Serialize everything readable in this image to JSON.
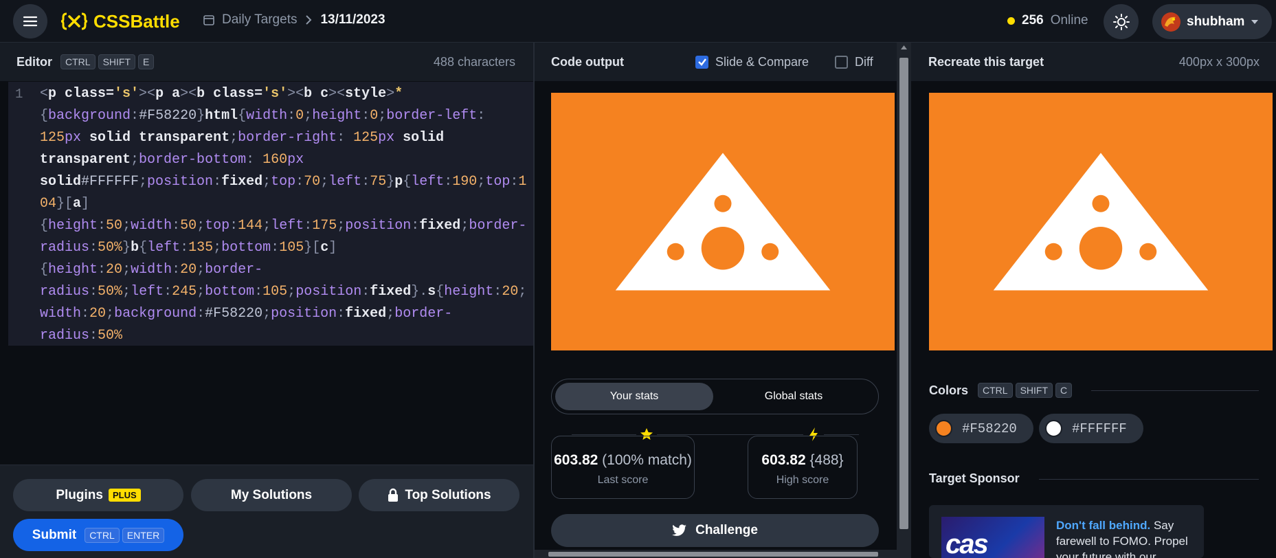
{
  "header": {
    "logo_text": "CSSBattle",
    "breadcrumb_section": "Daily Targets",
    "breadcrumb_date": "13/11/2023",
    "online_count": "256",
    "online_label": "Online",
    "username": "shubham"
  },
  "editor": {
    "title": "Editor",
    "shortcut": [
      "CTRL",
      "SHIFT",
      "E"
    ],
    "char_count": "488 characters",
    "line_number": "1"
  },
  "buttons": {
    "plugins": "Plugins",
    "plugins_badge": "PLUS",
    "my_solutions": "My Solutions",
    "top_solutions": "Top Solutions",
    "submit": "Submit",
    "submit_shortcut": [
      "CTRL",
      "ENTER"
    ]
  },
  "output": {
    "title": "Code output",
    "slide_compare": "Slide & Compare",
    "slide_compare_checked": true,
    "diff": "Diff",
    "diff_checked": false
  },
  "stats": {
    "tab_yours": "Your stats",
    "tab_global": "Global stats",
    "last_score": "603.82",
    "last_score_detail": "(100% match)",
    "last_score_label": "Last score",
    "high_score": "603.82",
    "high_score_detail": "{488}",
    "high_score_label": "High score",
    "challenge": "Challenge"
  },
  "target": {
    "title": "Recreate this target",
    "size": "400px x 300px",
    "colors_title": "Colors",
    "colors_shortcut": [
      "CTRL",
      "SHIFT",
      "C"
    ],
    "colors": [
      {
        "hex": "#F58220",
        "label": "#F58220"
      },
      {
        "hex": "#FFFFFF",
        "label": "#FFFFFF"
      }
    ],
    "sponsor_title": "Target Sponsor",
    "sponsor_image_text": "cas",
    "sponsor_highlight": "Don't fall behind.",
    "sponsor_body": "Say farewell to FOMO. Propel your future with our"
  },
  "theme": {
    "accent": "#ffdd00",
    "target_bg": "#F58220",
    "target_fg": "#FFFFFF",
    "submit_blue": "#1463e6"
  }
}
